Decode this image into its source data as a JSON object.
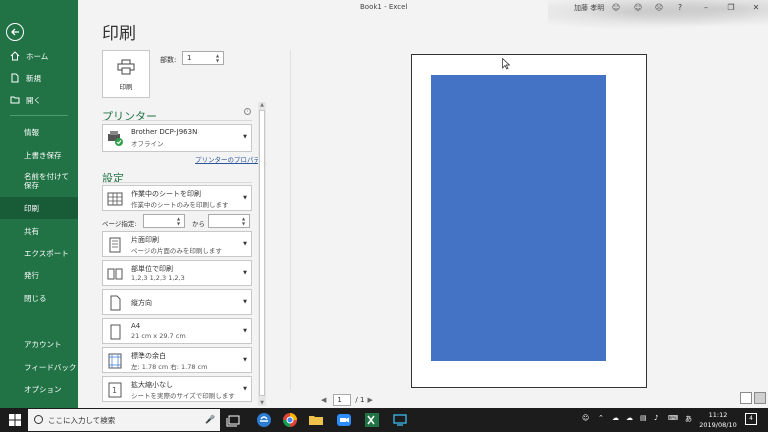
{
  "app": {
    "title": "Book1  -  Excel",
    "user": "加藤 孝明"
  },
  "colors": {
    "accent": "#217346",
    "preview_fill": "#4472c4"
  },
  "sidebar": {
    "home": "ホーム",
    "new": "新規",
    "open": "開く",
    "items": [
      "情報",
      "上書き保存",
      "名前を付けて保存",
      "印刷",
      "共有",
      "エクスポート",
      "発行",
      "閉じる"
    ],
    "bottom": [
      "アカウント",
      "フィードバック",
      "オプション"
    ]
  },
  "print": {
    "title": "印刷",
    "button": "印刷",
    "copies_label": "部数:",
    "copies_value": "1"
  },
  "printer": {
    "heading": "プリンター",
    "name": "Brother DCP-J963N",
    "status": "オフライン",
    "properties_link": "プリンターのプロパティ"
  },
  "settings": {
    "heading": "設定",
    "items": [
      {
        "l1": "作業中のシートを印刷",
        "l2": "作業中のシートのみを印刷します"
      },
      {
        "l1": "片面印刷",
        "l2": "ページの片面のみを印刷します"
      },
      {
        "l1": "部単位で印刷",
        "l2": "1,2,3    1,2,3    1,2,3"
      },
      {
        "l1": "縦方向",
        "l2": ""
      },
      {
        "l1": "A4",
        "l2": "21 cm x 29.7 cm"
      },
      {
        "l1": "標準の余白",
        "l2": "左:  1.78 cm    右:  1.78 cm"
      },
      {
        "l1": "拡大縮小なし",
        "l2": "シートを実際のサイズで印刷します"
      }
    ],
    "pages_label": "ページ指定:",
    "pages_to": "から"
  },
  "preview": {
    "page": "1",
    "of": "/ 1"
  },
  "taskbar": {
    "search_placeholder": "ここに入力して検索",
    "time": "11:12",
    "date": "2019/08/10",
    "ime": "あ",
    "notifications": "4"
  }
}
